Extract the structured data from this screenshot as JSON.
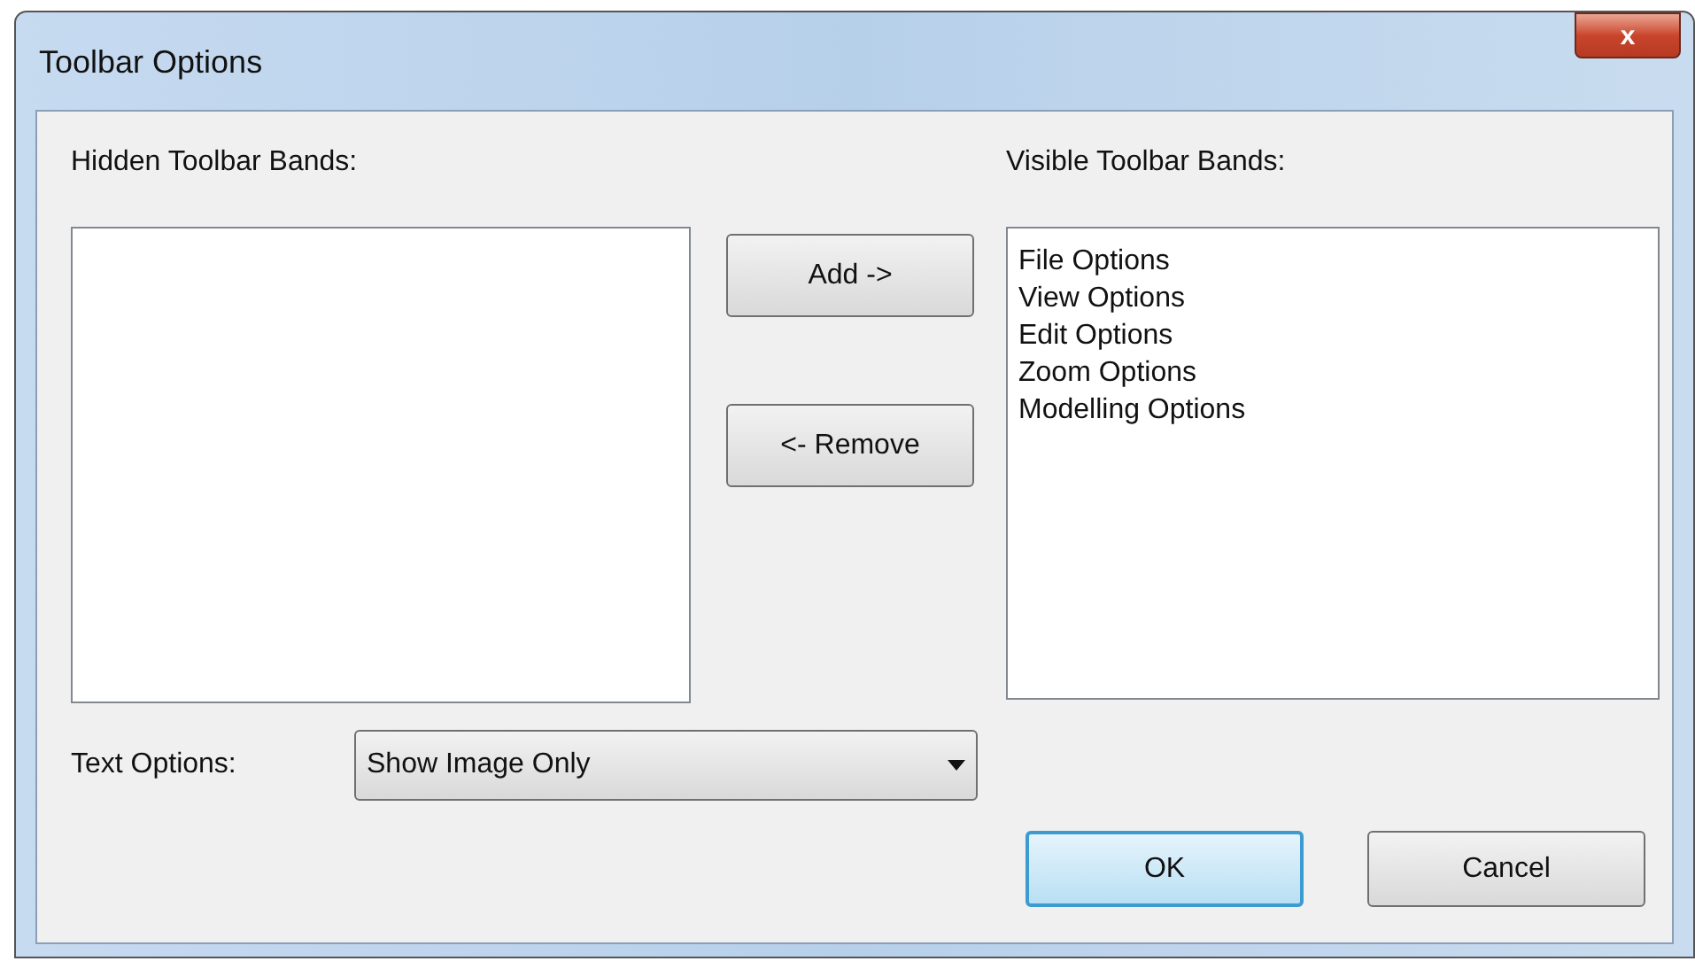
{
  "window": {
    "title": "Toolbar Options",
    "close": "x"
  },
  "hidden_bands": {
    "label": "Hidden Toolbar Bands:"
  },
  "visible_bands": {
    "label": "Visible Toolbar Bands:",
    "items": [
      {
        "label": "File Options"
      },
      {
        "label": "View Options"
      },
      {
        "label": "Edit Options"
      },
      {
        "label": "Zoom Options"
      },
      {
        "label": "Modelling Options"
      }
    ]
  },
  "move_buttons": [
    {
      "label": "Add ->"
    },
    {
      "label": "<- Remove"
    }
  ],
  "text_options": {
    "label": "Text Options:",
    "value": "Show Image Only"
  },
  "buttons": [
    {
      "label": "OK",
      "default": true
    },
    {
      "label": "Cancel",
      "default": false
    }
  ]
}
